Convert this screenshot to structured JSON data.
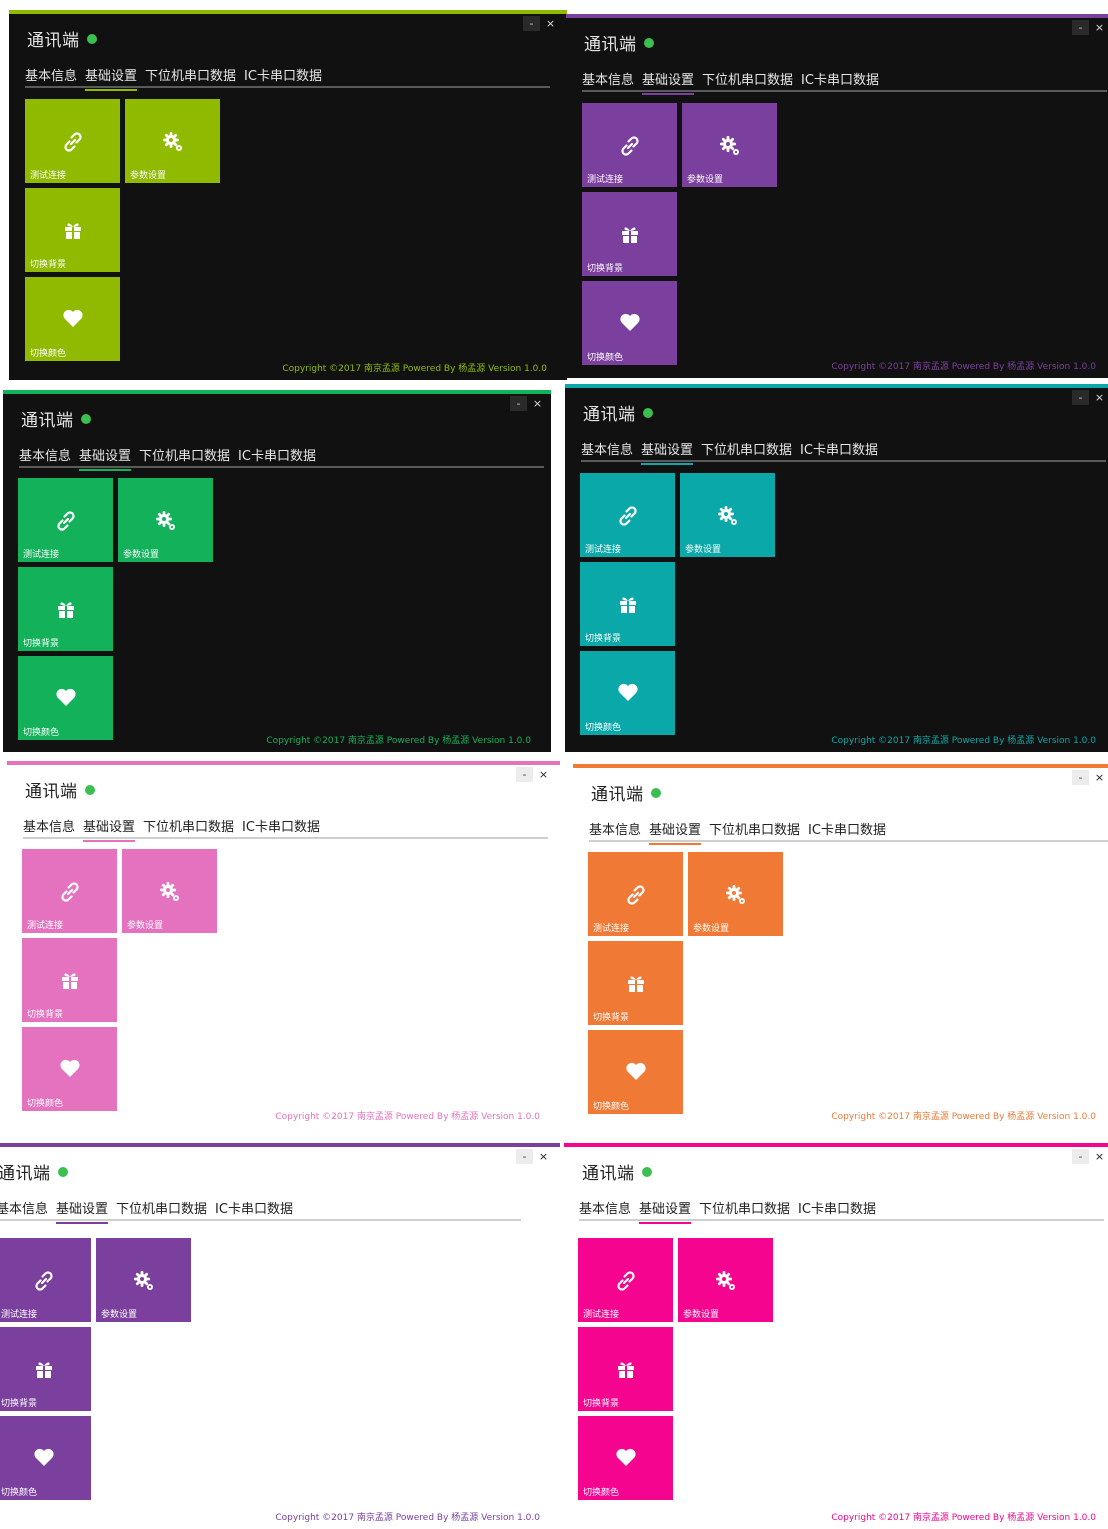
{
  "app": {
    "title": "通讯端",
    "tabs": [
      "基本信息",
      "基础设置",
      "下位机串口数据",
      "IC卡串口数据"
    ],
    "active_tab": "基础设置",
    "minimize_label": "-",
    "close_label": "×",
    "tiles": [
      {
        "label": "测试连接",
        "icon": "link-icon"
      },
      {
        "label": "参数设置",
        "icon": "gear-icon"
      },
      {
        "label": "切换背景",
        "icon": "gift-icon"
      },
      {
        "label": "切换颜色",
        "icon": "heart-icon"
      }
    ],
    "footer": "Copyright ©2017 南京孟源 Powered By 杨孟源 Version 1.0.0"
  },
  "panels": [
    {
      "theme": "dark",
      "accent": "#8fba00"
    },
    {
      "theme": "dark",
      "accent": "#7b3f9e"
    },
    {
      "theme": "dark",
      "accent": "#13b15a"
    },
    {
      "theme": "dark",
      "accent": "#0aa8a8"
    },
    {
      "theme": "light",
      "accent": "#e472bf"
    },
    {
      "theme": "light",
      "accent": "#f07a35"
    },
    {
      "theme": "light",
      "accent": "#7b3f9e"
    },
    {
      "theme": "light",
      "accent": "#f5058f"
    }
  ]
}
